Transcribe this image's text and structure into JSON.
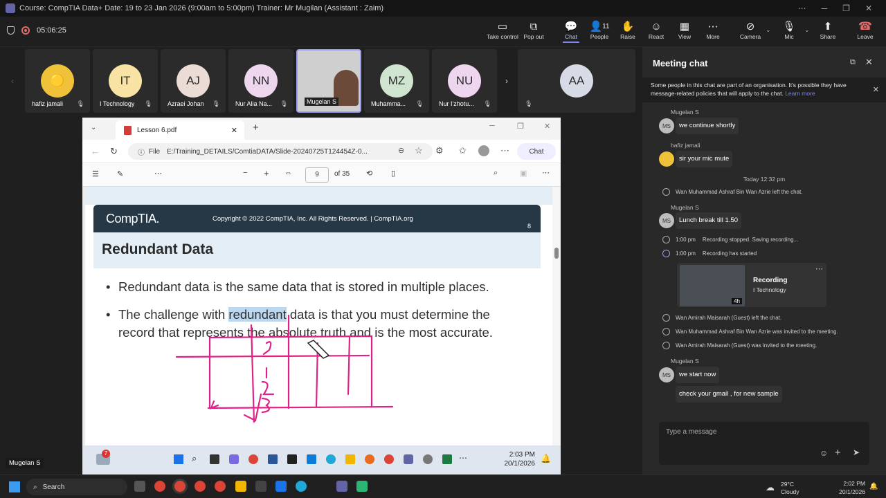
{
  "window": {
    "title": "Course: CompTIA Data+ Date: 19 to 23 Jan 2026 (9:00am to 5:00pm) Trainer: Mr Mugilan (Assistant : Zaim)"
  },
  "meeting": {
    "timer": "05:06:25",
    "toolbar": [
      {
        "label": "Take control",
        "icon": "screen-control-icon"
      },
      {
        "label": "Pop out",
        "icon": "pop-out-icon"
      },
      {
        "label": "Chat",
        "icon": "chat-icon",
        "active": true
      },
      {
        "label": "People",
        "icon": "people-icon",
        "count": "11"
      },
      {
        "label": "Raise",
        "icon": "hand-icon"
      },
      {
        "label": "React",
        "icon": "emoji-icon"
      },
      {
        "label": "View",
        "icon": "grid-icon"
      },
      {
        "label": "More",
        "icon": "more-icon"
      },
      {
        "label": "Camera",
        "icon": "camera-off-icon"
      },
      {
        "label": "Mic",
        "icon": "mic-off-icon"
      },
      {
        "label": "Share",
        "icon": "share-icon"
      }
    ],
    "leave_label": "Leave"
  },
  "participants": [
    {
      "name": "hafiz jamali",
      "initials": "",
      "avatar": "minion"
    },
    {
      "name": "I Technology",
      "initials": "IT"
    },
    {
      "name": "Azraei Johan",
      "initials": "AJ"
    },
    {
      "name": "Nur Alia Na...",
      "initials": "NN"
    },
    {
      "name": "Mugelan S",
      "initials": "",
      "video": true
    },
    {
      "name": "Muhamma...",
      "initials": "MZ"
    },
    {
      "name": "Nur I'zhotu...",
      "initials": "NU"
    },
    {
      "name": "",
      "initials": "AA"
    }
  ],
  "shared": {
    "tab_title": "Lesson 6.pdf",
    "file_label": "File",
    "url": "E:/Training_DETAILS/ComtiaDATA/Slide-20240725T124454Z-0...",
    "chat_btn": "Chat",
    "page_current": "9",
    "page_total": "of 35",
    "slide": {
      "logo": "CompTIA.",
      "copyright": "Copyright © 2022 CompTIA, Inc. All Rights Reserved.  |  CompTIA.org",
      "page_no": "8",
      "title": "Redundant Data",
      "bullet1": "Redundant data is the same data that is stored in multiple places.",
      "bullet2_a": "The challenge with ",
      "bullet2_hl": "redundant",
      "bullet2_b": " data is that you must determine the",
      "bullet2_c": "record that represents the absolute truth and is the most accurate."
    },
    "taskbar": {
      "time": "2:03 PM",
      "date": "20/1/2026",
      "badge": "7"
    }
  },
  "chat": {
    "title": "Meeting chat",
    "notice": "Some people in this chat are part of an organisation. It's possible they have message-related policies that will apply to the chat.",
    "learn_more": "Learn more",
    "messages": [
      {
        "sender": "Mugelan S",
        "initials": "MS",
        "text": "we continue shortly"
      },
      {
        "sender": "hafiz jamali",
        "text": "sir your mic mute"
      },
      {
        "day": "Today 12:32 pm"
      },
      {
        "system": "Wan Muhammad Ashraf Bin Wan Azrie left the chat."
      },
      {
        "sender": "Mugelan S",
        "initials": "MS",
        "text": "Lunch break till 1.50"
      },
      {
        "time": "1:00 pm",
        "system": "Recording stopped. Saving recording..."
      },
      {
        "time": "1:00 pm",
        "system": "Recording has started"
      },
      {
        "system": "Wan Amirah Maisarah (Guest) left the chat."
      },
      {
        "system": "Wan Muhammad Ashraf Bin Wan Azrie was invited to the meeting."
      },
      {
        "system": "Wan Amirah Maisarah (Guest) was invited to the meeting."
      },
      {
        "sender": "Mugelan S",
        "initials": "MS",
        "text": "we start now"
      },
      {
        "text": "check your gmail , for new sample"
      }
    ],
    "recording": {
      "title": "Recording",
      "subtitle": "I Technology",
      "duration": "4h"
    },
    "compose_placeholder": "Type a message"
  },
  "presenter_label": "Mugelan S",
  "taskbar": {
    "search": "Search",
    "weather_temp": "29°C",
    "weather_desc": "Cloudy",
    "time": "2:02 PM",
    "date": "20/1/2026"
  }
}
